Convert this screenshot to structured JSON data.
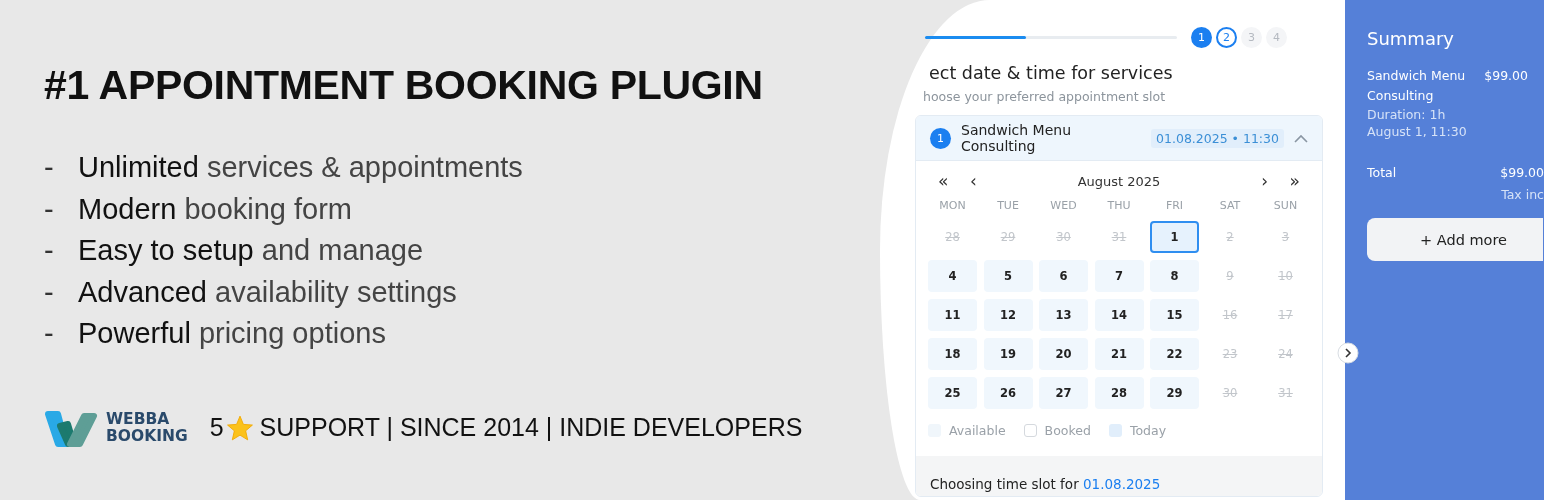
{
  "headline": "#1 APPOINTMENT BOOKING PLUGIN",
  "features": [
    {
      "marker": "-",
      "text": "**Unlimited** services & appointments"
    },
    {
      "marker": "-",
      "text": "**Modern** booking form"
    },
    {
      "marker": "-",
      "text": "**Easy to setup** and manage"
    },
    {
      "marker": "-",
      "text": "**Advanced** availability settings"
    },
    {
      "marker": "-",
      "text": "**Powerful** pricing options"
    }
  ],
  "brand": {
    "name_line1": "WEBBA",
    "name_line2": "BOOKING",
    "rating": "5",
    "tagline": "SUPPORT | SINCE 2014 | INDIE DEVELOPERS"
  },
  "booking_form": {
    "progress": {
      "level": 0.4
    },
    "steps": [
      {
        "label": "1",
        "kind": "done"
      },
      {
        "label": "2",
        "kind": "current"
      },
      {
        "label": "3",
        "kind": "pending"
      },
      {
        "label": "4",
        "kind": "pending"
      }
    ],
    "title": "ect date & time for services",
    "subtitle": "hoose your preferred appointment slot",
    "service": {
      "number": "1",
      "name": "Sandwich Menu Consulting",
      "slot": "01.08.2025 • 11:30",
      "expanded": true
    },
    "calendar": {
      "first": "«",
      "prev": "‹",
      "month": "August 2025",
      "next": "›",
      "last": "»",
      "weekdays": [
        "MON",
        "TUE",
        "WED",
        "THU",
        "FRI",
        "SAT",
        "SUN"
      ],
      "days": [
        {
          "label": "28",
          "available": false,
          "selected": false
        },
        {
          "label": "29",
          "available": false,
          "selected": false
        },
        {
          "label": "30",
          "available": false,
          "selected": false
        },
        {
          "label": "31",
          "available": false,
          "selected": false
        },
        {
          "label": "1",
          "available": true,
          "selected": true
        },
        {
          "label": "2",
          "available": false,
          "selected": false
        },
        {
          "label": "3",
          "available": false,
          "selected": false
        },
        {
          "label": "4",
          "available": true,
          "selected": false
        },
        {
          "label": "5",
          "available": true,
          "selected": false
        },
        {
          "label": "6",
          "available": true,
          "selected": false
        },
        {
          "label": "7",
          "available": true,
          "selected": false
        },
        {
          "label": "8",
          "available": true,
          "selected": false
        },
        {
          "label": "9",
          "available": false,
          "selected": false
        },
        {
          "label": "10",
          "available": false,
          "selected": false
        },
        {
          "label": "11",
          "available": true,
          "selected": false
        },
        {
          "label": "12",
          "available": true,
          "selected": false
        },
        {
          "label": "13",
          "available": true,
          "selected": false
        },
        {
          "label": "14",
          "available": true,
          "selected": false
        },
        {
          "label": "15",
          "available": true,
          "selected": false
        },
        {
          "label": "16",
          "available": false,
          "selected": false
        },
        {
          "label": "17",
          "available": false,
          "selected": false
        },
        {
          "label": "18",
          "available": true,
          "selected": false
        },
        {
          "label": "19",
          "available": true,
          "selected": false
        },
        {
          "label": "20",
          "available": true,
          "selected": false
        },
        {
          "label": "21",
          "available": true,
          "selected": false
        },
        {
          "label": "22",
          "available": true,
          "selected": false
        },
        {
          "label": "23",
          "available": false,
          "selected": false
        },
        {
          "label": "24",
          "available": false,
          "selected": false
        },
        {
          "label": "25",
          "available": true,
          "selected": false
        },
        {
          "label": "26",
          "available": true,
          "selected": false
        },
        {
          "label": "27",
          "available": true,
          "selected": false
        },
        {
          "label": "28",
          "available": true,
          "selected": false
        },
        {
          "label": "29",
          "available": true,
          "selected": false
        },
        {
          "label": "30",
          "available": false,
          "selected": false
        },
        {
          "label": "31",
          "available": false,
          "selected": false
        }
      ],
      "legend": [
        {
          "label": "Available",
          "kind": "available"
        },
        {
          "label": "Booked",
          "kind": "booked"
        },
        {
          "label": "Today",
          "kind": "today"
        }
      ]
    },
    "time_slot_prefix": "Choosing time slot for",
    "time_slot_date": "01.08.2025"
  },
  "summary": {
    "title": "Summary",
    "item_name": "Sandwich Menu Consulting",
    "item_price": "$99.00",
    "duration": "Duration: 1h",
    "date": "August 1, 11:30",
    "total_label": "Total",
    "total_price": "$99.00",
    "tax_note": "Tax inc",
    "add_button": "+ Add more"
  }
}
